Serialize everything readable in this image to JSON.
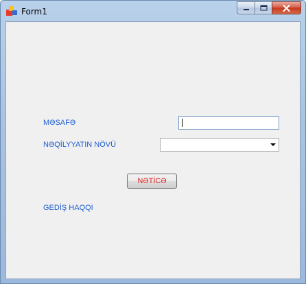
{
  "window": {
    "title": "Form1"
  },
  "form": {
    "distance_label": "MƏSAFƏ",
    "distance_value": "",
    "transport_type_label": "NƏQİLYYATIN NÖVÜ",
    "transport_type_selected": "",
    "result_button": "NƏTİCƏ",
    "fare_label": "GEDİŞ HAQQI"
  },
  "colors": {
    "label_text": "#1f5fd0",
    "button_text": "#e0201c"
  }
}
